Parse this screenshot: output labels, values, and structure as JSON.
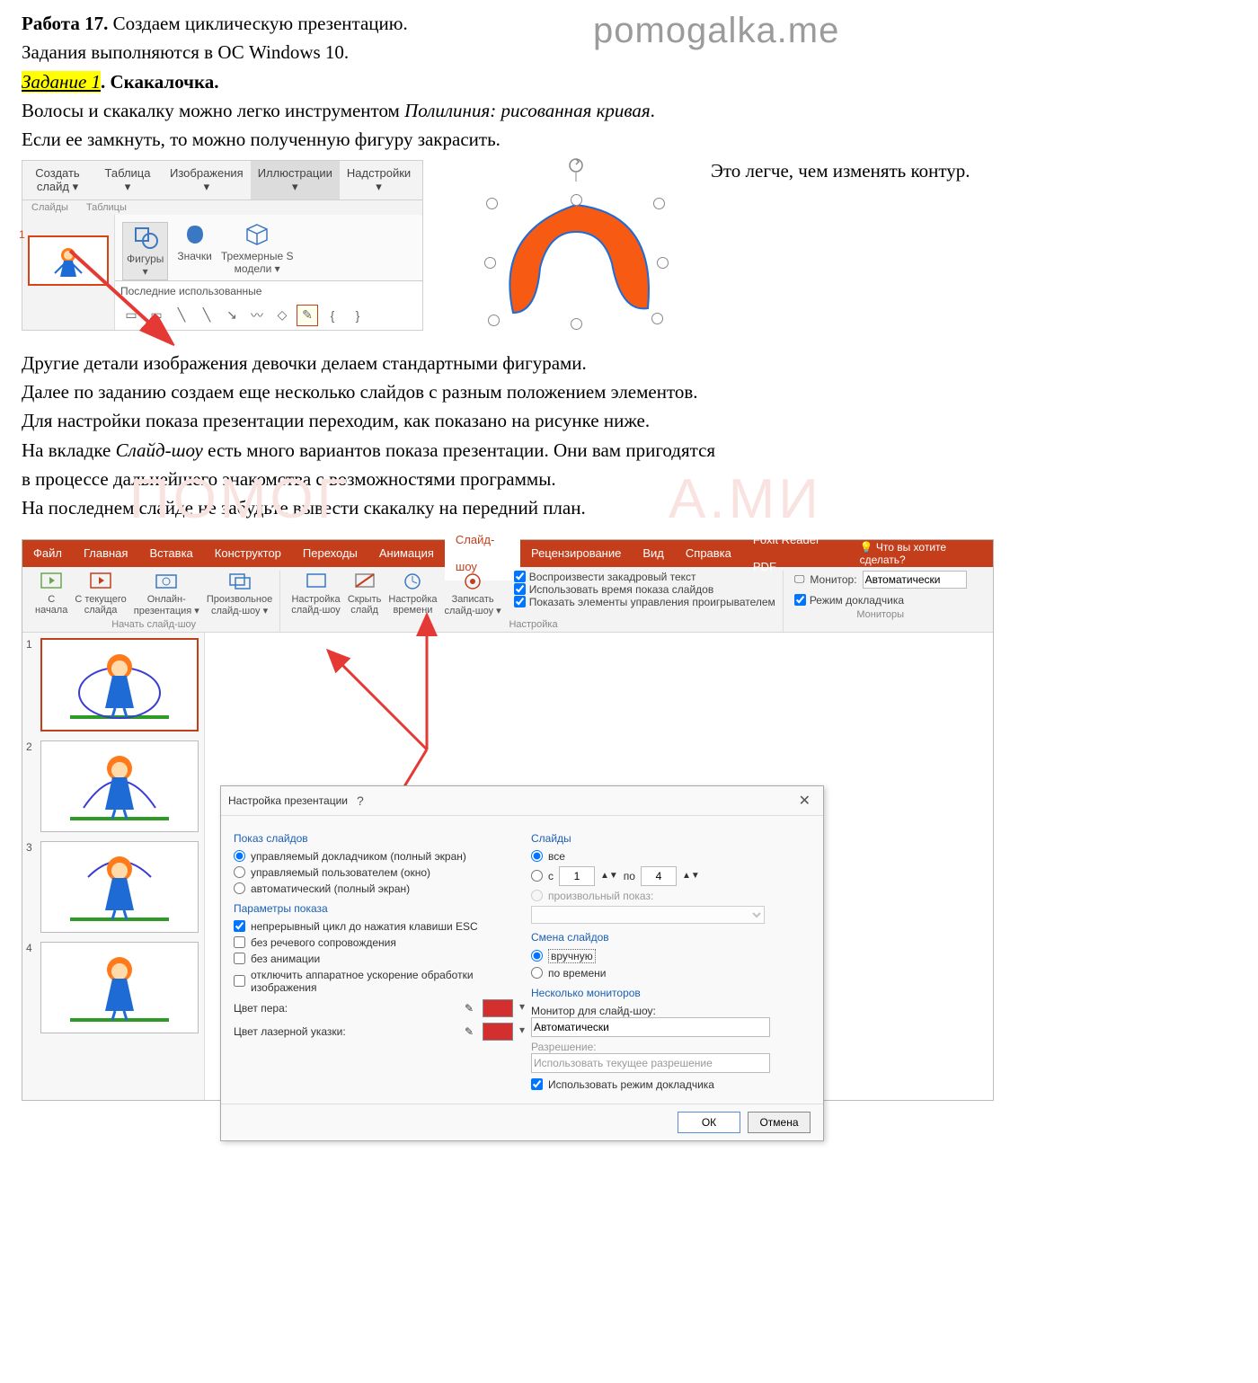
{
  "watermark": "pomogalka.me",
  "wm2_left": "ПОМОГ",
  "wm2_right": "А.МИ",
  "intro": {
    "work_bold": "Работа 17.",
    "work_rest": " Создаем циклическую презентацию.",
    "line2": "Задания выполняются в ОС Windows 10.",
    "task_hl": "Задание 1",
    "task_bold": ". Скакалочка.",
    "line4a": "Волосы и скакалку можно легко инструментом ",
    "line4i": "Полилиния: рисованная кривая",
    "line4b": ".",
    "line5": "Если ее замкнуть, то можно полученную фигуру закрасить."
  },
  "fig1": {
    "tabs": [
      "Создать\nслайд ▾",
      "Таблица\n▾",
      "Изображения\n▾",
      "Иллюстрации\n▾",
      "Надстройки\n▾"
    ],
    "groups": [
      "Слайды",
      "Таблицы"
    ],
    "thumb_num": "1",
    "illus_btns": [
      "Фигуры\n▾",
      "Значки",
      "Трехмерные S\nмодели ▾"
    ],
    "last_used": "Последние использованные",
    "note": "Это легче, чем изменять контур."
  },
  "para2": {
    "l1": "Другие детали изображения девочки делаем стандартными фигурами.",
    "l2": "Далее по заданию создаем еще несколько слайдов с разным положением элементов.",
    "l3": "Для настройки показа презентации переходим, как показано на рисунке ниже.",
    "l4a": "На вкладке ",
    "l4i": "Слайд-шоу",
    "l4b": " есть много вариантов показа презентации. Они вам пригодятся",
    "l5": "в процессе дальнейшего знакомства с возможностями программы.",
    "l6": "На последнем слайде не забудьте вывести скакалку на передний план."
  },
  "pp": {
    "tabs": [
      "Файл",
      "Главная",
      "Вставка",
      "Конструктор",
      "Переходы",
      "Анимация",
      "Слайд-шоу",
      "Рецензирование",
      "Вид",
      "Справка",
      "Foxit Reader PDF"
    ],
    "help_hint": "Что вы хотите сделать?",
    "grp_start_buttons": [
      "С\nначала",
      "С текущего\nслайда",
      "Онлайн-\nпрезентация ▾",
      "Произвольное\nслайд-шоу ▾"
    ],
    "grp_start_label": "Начать слайд-шоу",
    "grp_set_buttons": [
      "Настройка\nслайд-шоу",
      "Скрыть\nслайд",
      "Настройка\nвремени",
      "Записать\nслайд-шоу ▾"
    ],
    "grp_set_checks": [
      "Воспроизвести закадровый текст",
      "Использовать время показа слайдов",
      "Показать элементы управления проигрывателем"
    ],
    "grp_set_label": "Настройка",
    "monitor_label": "Монитор:",
    "monitor_value": "Автоматически",
    "presenter_mode": "Режим докладчика",
    "grp_mon_label": "Мониторы",
    "thumbs": [
      "1",
      "2",
      "3",
      "4"
    ]
  },
  "dlg": {
    "title": "Настройка презентации",
    "sec_show": "Показ слайдов",
    "show_opts": [
      "управляемый докладчиком (полный экран)",
      "управляемый пользователем (окно)",
      "автоматический (полный экран)"
    ],
    "sec_params": "Параметры показа",
    "params": [
      "непрерывный цикл до нажатия клавиши ESC",
      "без речевого сопровождения",
      "без анимации",
      "отключить аппаратное ускорение обработки изображения"
    ],
    "pen_color": "Цвет пера:",
    "laser_color": "Цвет лазерной указки:",
    "sec_slides": "Слайды",
    "slides_all": "все",
    "slides_from": "с",
    "slides_to": "по",
    "from_val": "1",
    "to_val": "4",
    "slides_custom": "произвольный показ:",
    "sec_change": "Смена слайдов",
    "change_opts": [
      "вручную",
      "по времени"
    ],
    "sec_mon": "Несколько мониторов",
    "mon_for": "Монитор для слайд-шоу:",
    "mon_val": "Автоматически",
    "res_label": "Разрешение:",
    "res_val": "Использовать текущее разрешение",
    "use_presenter": "Использовать режим докладчика",
    "ok": "ОК",
    "cancel": "Отмена"
  }
}
